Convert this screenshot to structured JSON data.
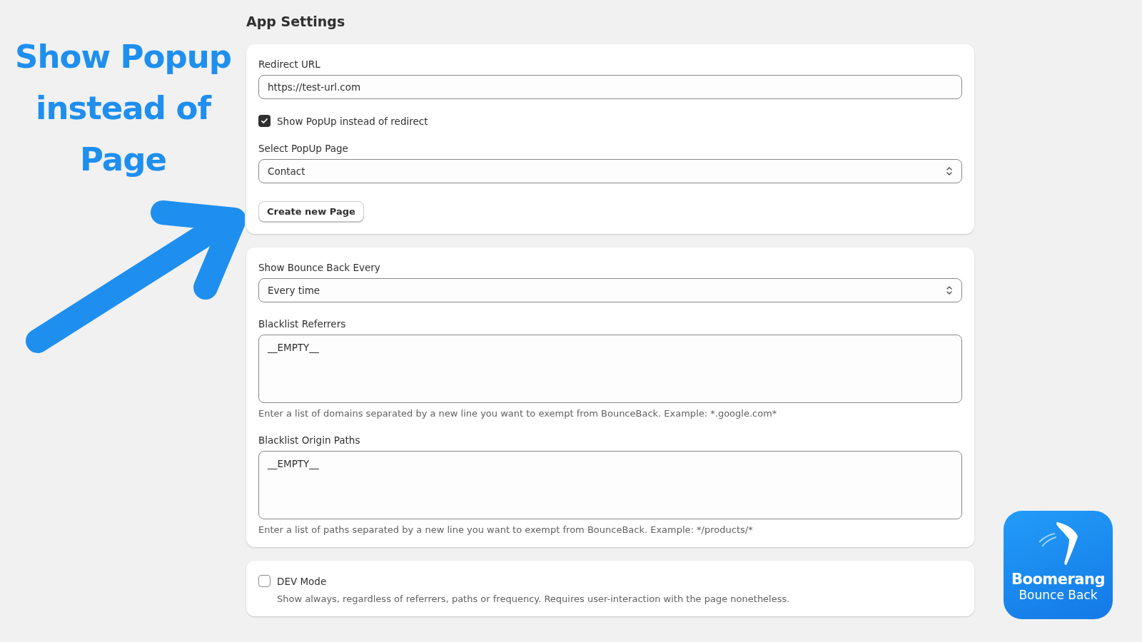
{
  "promo": {
    "headline": "Show Popup instead of Page"
  },
  "page_title": "App Settings",
  "cards": [
    {
      "fields": [
        {
          "kind": "text",
          "label": "Redirect URL",
          "value": "https://test-url.com"
        },
        {
          "kind": "checkbox",
          "label": "Show PopUp instead of redirect",
          "checked": true
        },
        {
          "kind": "select",
          "label": "Select PopUp Page",
          "value": "Contact"
        },
        {
          "kind": "button",
          "label": "Create new Page"
        }
      ]
    },
    {
      "fields": [
        {
          "kind": "select",
          "label": "Show Bounce Back Every",
          "value": "Every time"
        },
        {
          "kind": "textarea",
          "label": "Blacklist Referrers",
          "value": "__EMPTY__",
          "help": "Enter a list of domains separated by a new line you want to exempt from BounceBack. Example: *.google.com*"
        },
        {
          "kind": "textarea",
          "label": "Blacklist Origin Paths",
          "value": "__EMPTY__",
          "help": "Enter a list of paths separated by a new line you want to exempt from BounceBack. Example: */products/*"
        }
      ]
    },
    {
      "fields": [
        {
          "kind": "checkbox",
          "label": "DEV Mode",
          "checked": false,
          "help": "Show always, regardless of referrers, paths or frequency. Requires user-interaction with the page nonetheless."
        }
      ]
    }
  ],
  "logo": {
    "title": "Boomerang",
    "subtitle": "Bounce Back"
  }
}
